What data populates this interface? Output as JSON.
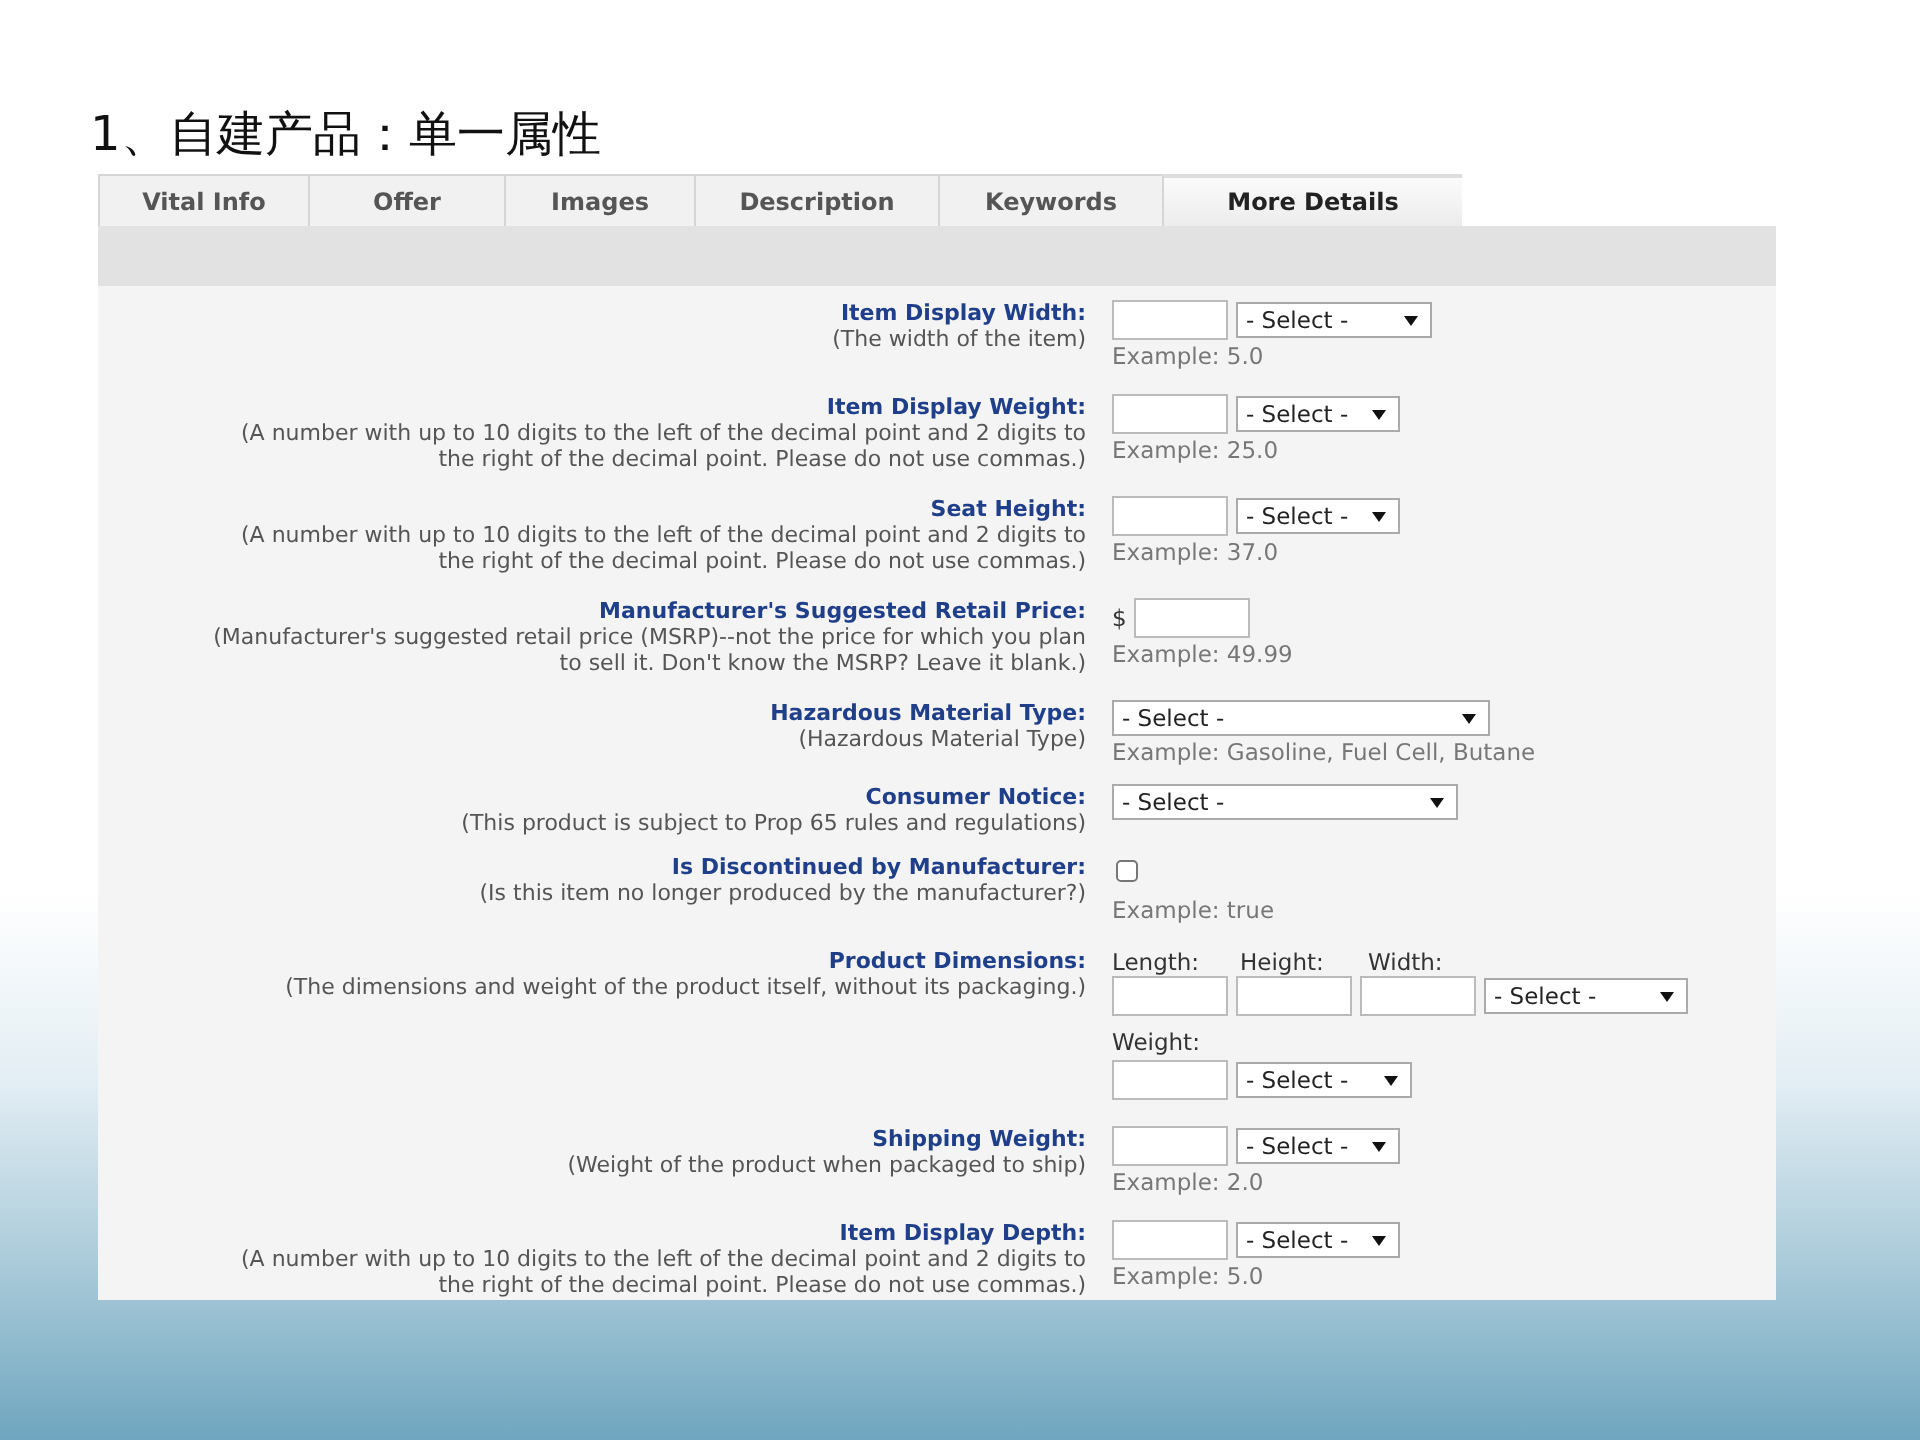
{
  "heading": "1、自建产品：单一属性",
  "tabs": [
    {
      "label": "Vital Info",
      "selected": false
    },
    {
      "label": "Offer",
      "selected": false
    },
    {
      "label": "Images",
      "selected": false
    },
    {
      "label": "Description",
      "selected": false
    },
    {
      "label": "Keywords",
      "selected": false
    },
    {
      "label": "More Details",
      "selected": true
    }
  ],
  "fields": [
    {
      "kind": "unit",
      "label": "Item Display Width:",
      "hint": [
        "(The width of the item)"
      ],
      "select": "- Select -",
      "example": "Example: 5.0"
    },
    {
      "kind": "unit",
      "label": "Item Display Weight:",
      "hint": [
        "(A number with up to 10 digits to the left of the decimal point and 2 digits to",
        "the right of the decimal point. Please do not use commas.)"
      ],
      "select": "- Select -",
      "example": "Example: 25.0"
    },
    {
      "kind": "unit",
      "label": "Seat Height:",
      "hint": [
        "(A number with up to 10 digits to the left of the decimal point and 2 digits to",
        "the right of the decimal point. Please do not use commas.)"
      ],
      "select": "- Select -",
      "example": "Example: 37.0"
    },
    {
      "kind": "price",
      "label": "Manufacturer's Suggested Retail Price:",
      "hint": [
        "(Manufacturer's suggested retail price (MSRP)--not the price for which you plan",
        "to sell it. Don't know the MSRP? Leave it blank.)"
      ],
      "currency": "$",
      "example": "Example: 49.99"
    },
    {
      "kind": "select",
      "label": "Hazardous Material Type:",
      "hint": [
        "(Hazardous Material Type)"
      ],
      "select": "- Select -",
      "example": "Example: Gasoline, Fuel Cell, Butane"
    },
    {
      "kind": "select",
      "label": "Consumer Notice:",
      "hint": [
        "(This product is subject to Prop 65 rules and regulations)"
      ],
      "select": "- Select -"
    },
    {
      "kind": "checkbox",
      "label": "Is Discontinued by Manufacturer:",
      "hint": [
        "(Is this item no longer produced by the manufacturer?)"
      ],
      "checked": false,
      "example": "Example: true"
    },
    {
      "kind": "dimensions",
      "label": "Product Dimensions:",
      "hint": [
        "(The dimensions and weight of the product itself, without its packaging.)"
      ],
      "dims": [
        "Length:",
        "Height:",
        "Width:"
      ],
      "select": "- Select -",
      "weight_label": "Weight:",
      "weight_select": "- Select -"
    },
    {
      "kind": "unit",
      "label": "Shipping Weight:",
      "hint": [
        "(Weight of the product when packaged to ship)"
      ],
      "select": "- Select -",
      "example": "Example: 2.0"
    },
    {
      "kind": "unit",
      "label": "Item Display Depth:",
      "hint": [
        "(A number with up to 10 digits to the left of the decimal point and 2 digits to",
        "the right of the decimal point. Please do not use commas.)"
      ],
      "select": "- Select -",
      "example": "Example: 5.0"
    }
  ]
}
